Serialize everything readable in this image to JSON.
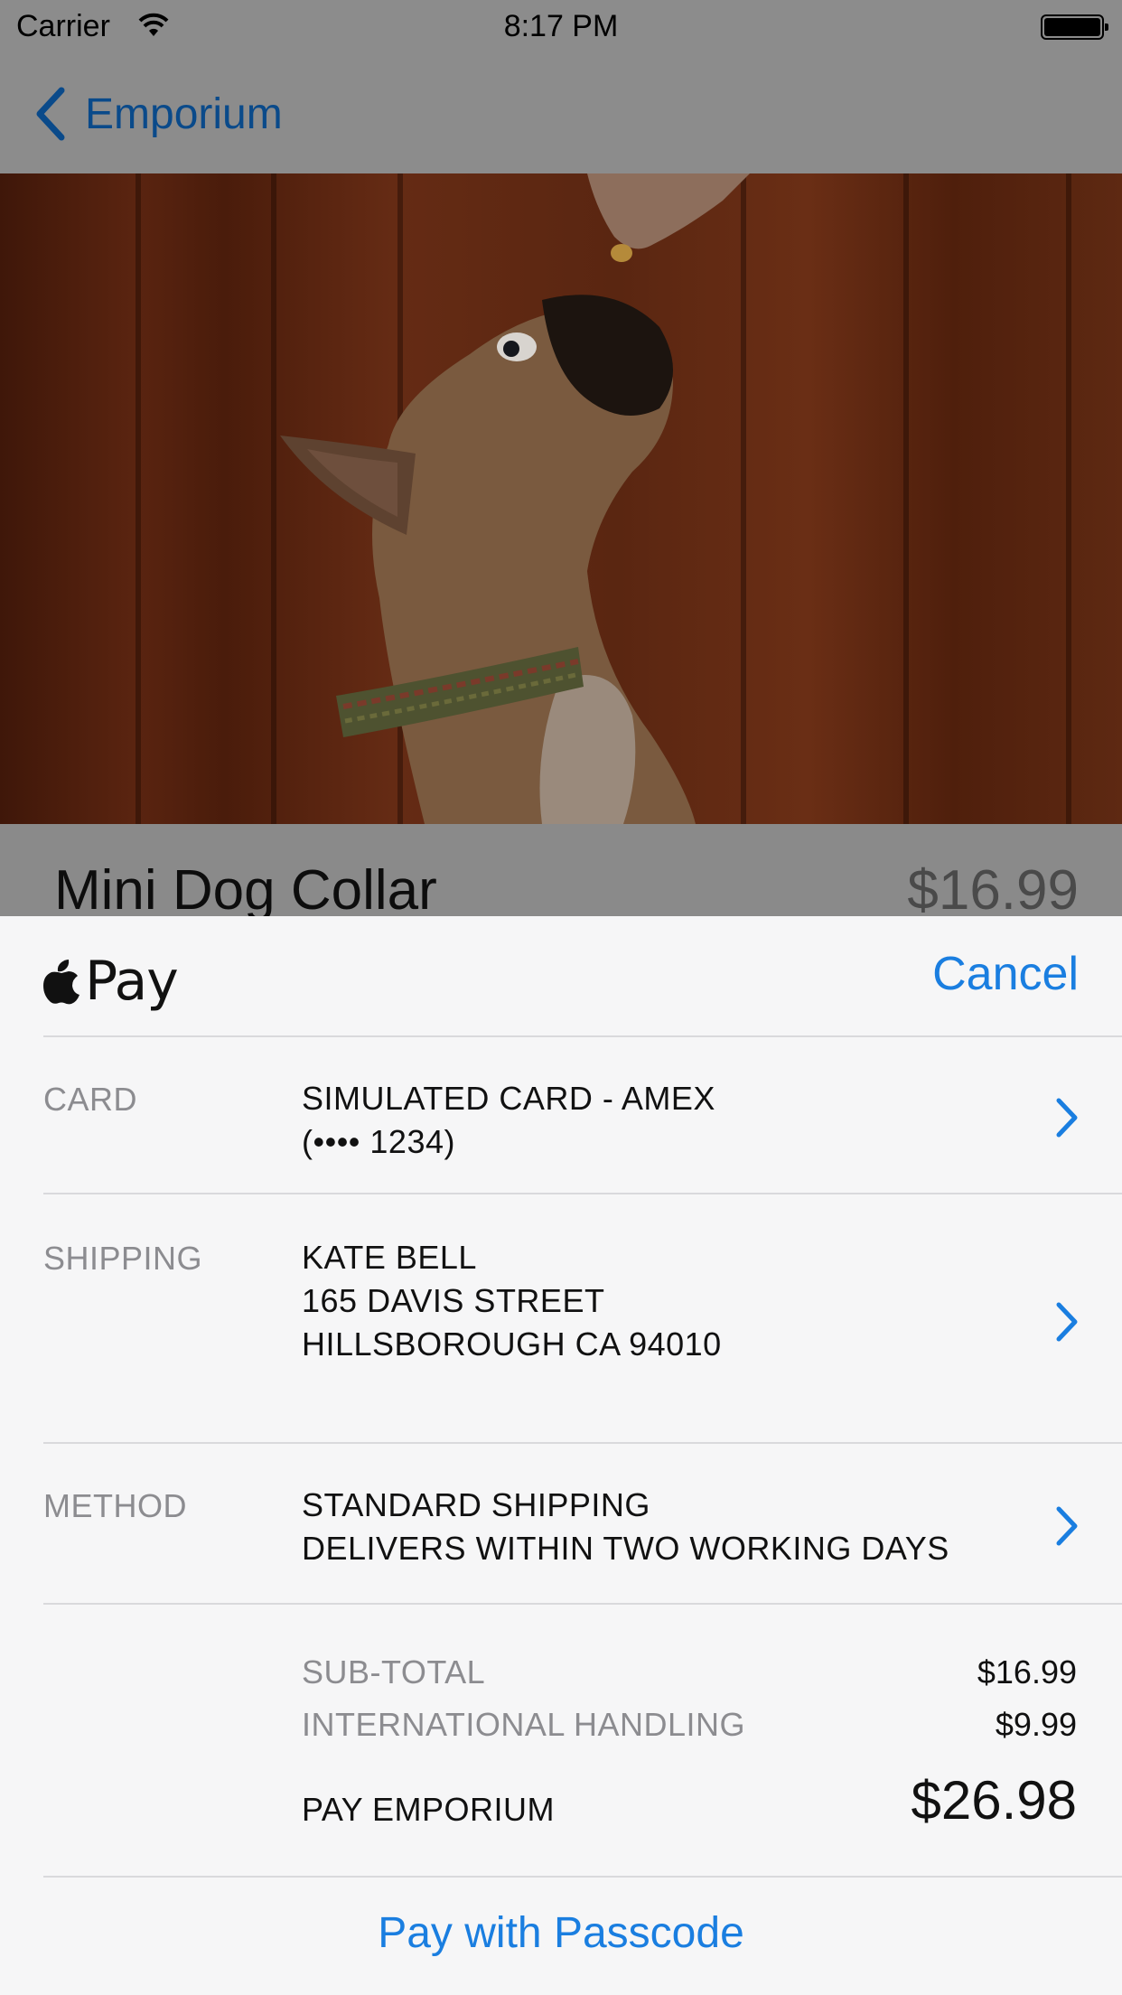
{
  "status_bar": {
    "carrier": "Carrier",
    "time": "8:17 PM"
  },
  "nav": {
    "back_label": "Emporium"
  },
  "product": {
    "name": "Mini Dog Collar",
    "price": "$16.99"
  },
  "sheet": {
    "brand": "Pay",
    "cancel_label": "Cancel",
    "card": {
      "label": "CARD",
      "lines": [
        "SIMULATED CARD - AMEX",
        "(•••• 1234)"
      ]
    },
    "shipping": {
      "label": "SHIPPING",
      "lines": [
        "KATE BELL",
        "165 DAVIS STREET",
        "HILLSBOROUGH CA 94010"
      ]
    },
    "method": {
      "label": "METHOD",
      "lines": [
        "STANDARD SHIPPING",
        "DELIVERS WITHIN TWO WORKING DAYS"
      ]
    },
    "summary": {
      "subtotal_label": "SUB-TOTAL",
      "subtotal_value": "$16.99",
      "handling_label": "INTERNATIONAL HANDLING",
      "handling_value": "$9.99",
      "total_label": "PAY EMPORIUM",
      "total_value": "$26.98"
    },
    "pay_button_label": "Pay with Passcode"
  },
  "colors": {
    "accent": "#1a7ee0",
    "sheet_background": "#f6f6f7",
    "dim_overlay": "#8a8a8a"
  }
}
